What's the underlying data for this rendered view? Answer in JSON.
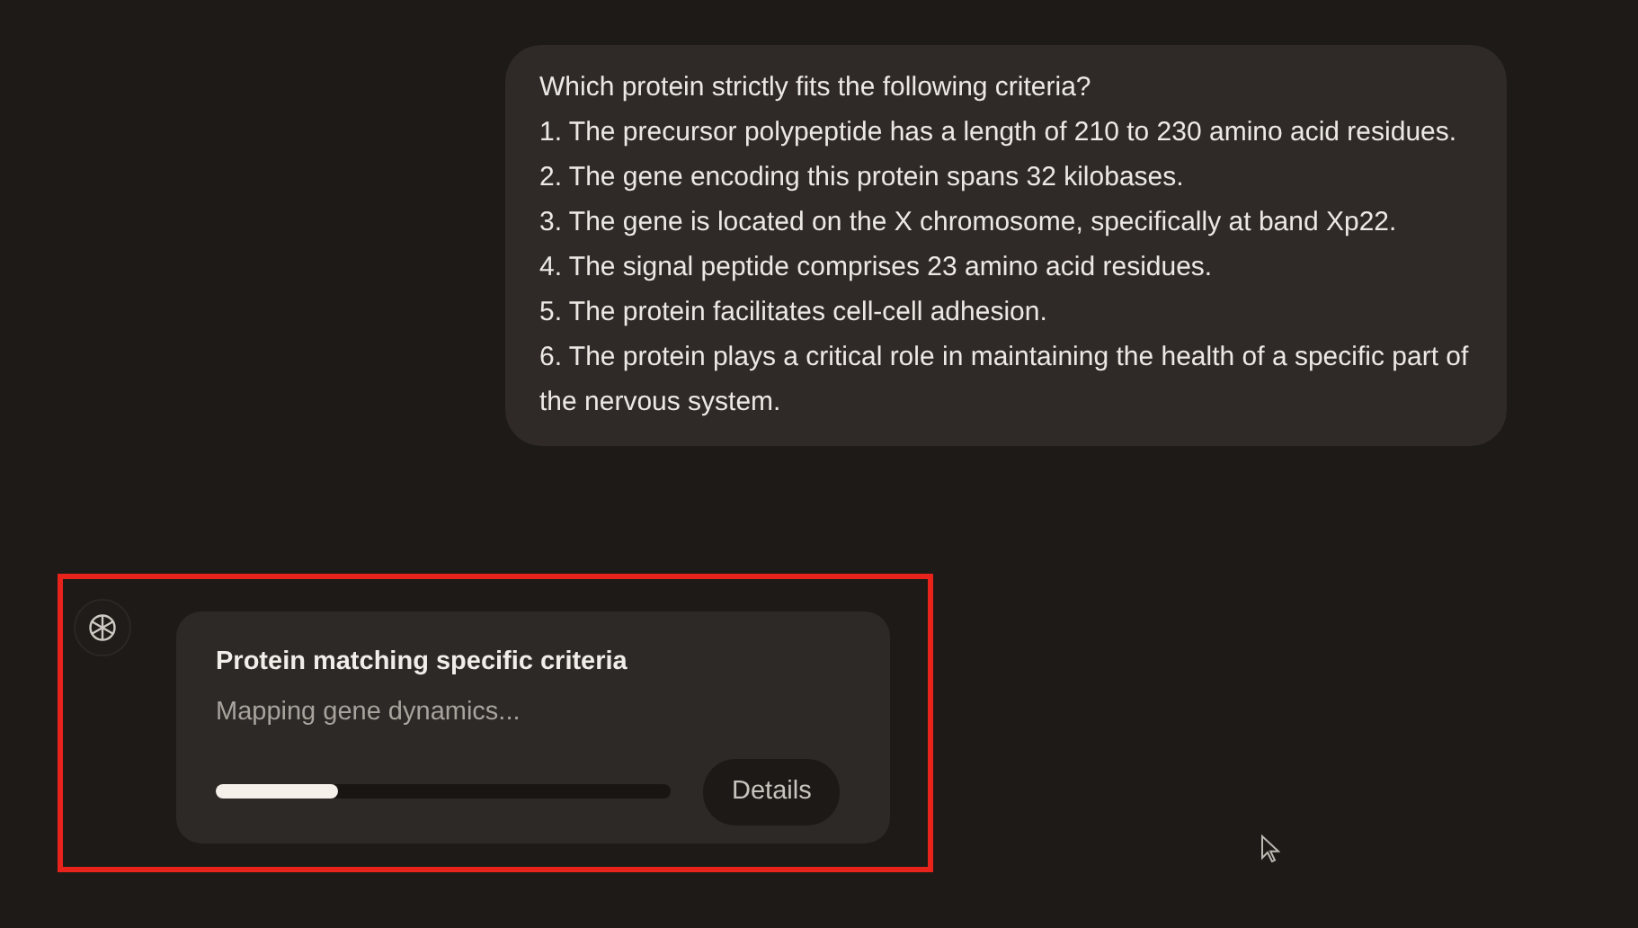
{
  "user_message": {
    "lines": [
      "Which protein strictly fits the following criteria?",
      "1. The precursor polypeptide has a length of 210 to 230 amino acid residues.",
      "2. The gene encoding this protein spans 32 kilobases.",
      "3. The gene is located on the X chromosome, specifically at band Xp22.",
      "4. The signal peptide comprises 23 amino acid residues.",
      "5. The protein facilitates cell-cell adhesion.",
      "6. The protein plays a critical role in maintaining the health of a specific part of the nervous system."
    ]
  },
  "task_card": {
    "highlighted": true,
    "title": "Protein matching specific criteria",
    "status": "Mapping gene dynamics...",
    "level": 0.27,
    "button": "Details"
  }
}
